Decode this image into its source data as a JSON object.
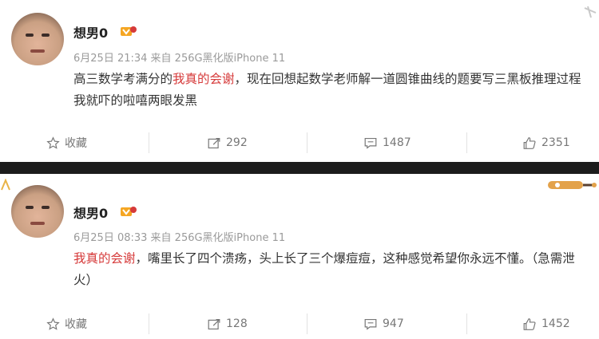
{
  "posts": [
    {
      "user": "想男0",
      "meta": "6月25日 21:34 来自 256G黑化版iPhone 11",
      "content_highlight": "我真的会谢",
      "content_pre": "高三数学考满分的",
      "content_post": "，现在回想起数学老师解一道圆锥曲线的题要写三黑板推理过程我就吓的啦嘻两眼发黑",
      "actions": {
        "favorite": "收藏",
        "repost": "292",
        "comment": "1487",
        "like": "2351"
      }
    },
    {
      "user": "想男0",
      "meta": "6月25日 08:33 来自 256G黑化版iPhone 11",
      "content_highlight": "我真的会谢",
      "content_pre": "",
      "content_post": "，嘴里长了四个溃疡，头上长了三个爆痘痘，这种感觉希望你永远不懂。（急需泄火）",
      "actions": {
        "favorite": "收藏",
        "repost": "128",
        "comment": "947",
        "like": "1452"
      }
    }
  ],
  "colors": {
    "highlight": "#d63a3a",
    "divider": "#1c1c1c",
    "meta": "#9a9a9a"
  }
}
